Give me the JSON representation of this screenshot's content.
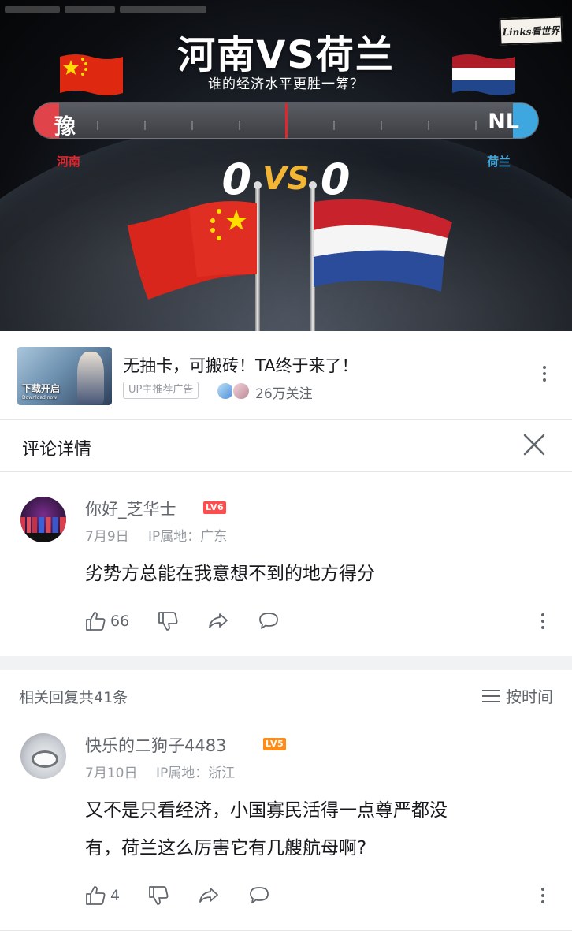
{
  "video": {
    "title": "河南VS荷兰",
    "subtitle": "谁的经济水平更胜一筹？",
    "watermark": "Links看世界",
    "bar_left_label": "豫",
    "bar_right_label": "NL",
    "left_name": "河南",
    "right_name": "荷兰",
    "left_score": "0",
    "vs_label": "VS",
    "right_score": "0",
    "colors": {
      "left": "#e0262e",
      "right": "#3fa7e0",
      "vs": "#f2b634"
    }
  },
  "ad": {
    "thumb_label": "下载开启",
    "thumb_sub": "Download now",
    "title": "无抽卡，可搬砖！TA终于来了！",
    "badge": "UP主推荐广告",
    "followers": "26万关注"
  },
  "comment_detail": {
    "title": "评论详情"
  },
  "main_comment": {
    "username": "你好_芝华士",
    "level": "LV6",
    "date": "7月9日",
    "ip": "IP属地：广东",
    "text": "劣势方总能在我意想不到的地方得分",
    "likes": "66"
  },
  "replies": {
    "count_label": "相关回复共41条",
    "sort_label": "按时间"
  },
  "reply": {
    "username": "快乐的二狗子4483",
    "level": "LV5",
    "date": "7月10日",
    "ip": "IP属地：浙江",
    "text_line1": "又不是只看经济，小国寡民活得一点尊严都没",
    "text_line2": "有，荷兰这么厉害它有几艘航母啊?",
    "likes": "4"
  },
  "icons": [
    "thumb-up-icon",
    "thumb-down-icon",
    "share-icon",
    "comment-icon",
    "more-icon",
    "close-icon",
    "sort-icon"
  ]
}
